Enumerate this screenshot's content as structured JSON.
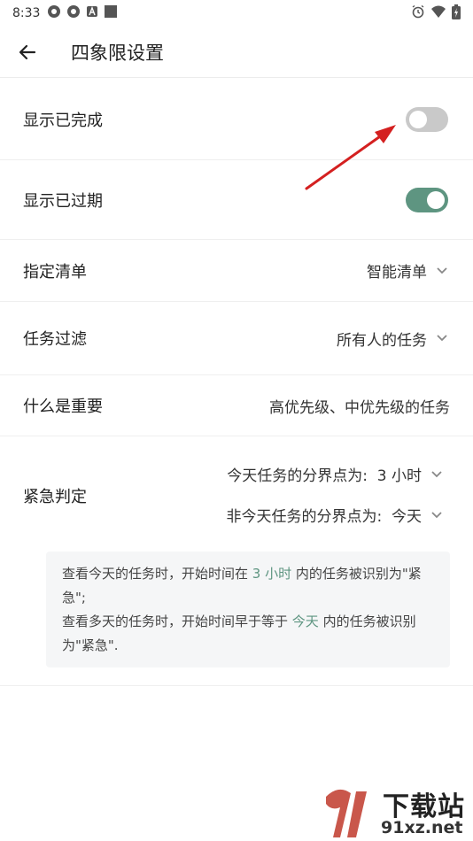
{
  "status_bar": {
    "time": "8:33"
  },
  "header": {
    "title": "四象限设置"
  },
  "settings": {
    "show_completed": {
      "label": "显示已完成",
      "enabled": false
    },
    "show_overdue": {
      "label": "显示已过期",
      "enabled": true
    },
    "assign_list": {
      "label": "指定清单",
      "value": "智能清单"
    },
    "task_filter": {
      "label": "任务过滤",
      "value": "所有人的任务"
    },
    "what_is_important": {
      "label": "什么是重要",
      "value": "高优先级、中优先级的任务"
    },
    "urgent": {
      "label": "紧急判定",
      "today_option": "今天任务的分界点为:  3 小时",
      "nontoday_option": "非今天任务的分界点为:  今天",
      "note": {
        "line1_a": "查看今天的任务时，开始时间在 ",
        "line1_hl": "3 小时",
        "line1_b": " 内的任务被识别为\"紧急\";",
        "line2_a": "查看多天的任务时，开始时间早于等于 ",
        "line2_hl": "今天",
        "line2_b": " 内的任务被识别为\"紧急\"."
      }
    }
  },
  "watermark": {
    "line1": "下载站",
    "line2": "91xz.net"
  },
  "colors": {
    "accent": "#5e9581",
    "toggle_off": "#c9c9c9",
    "arrow": "#d42020"
  }
}
